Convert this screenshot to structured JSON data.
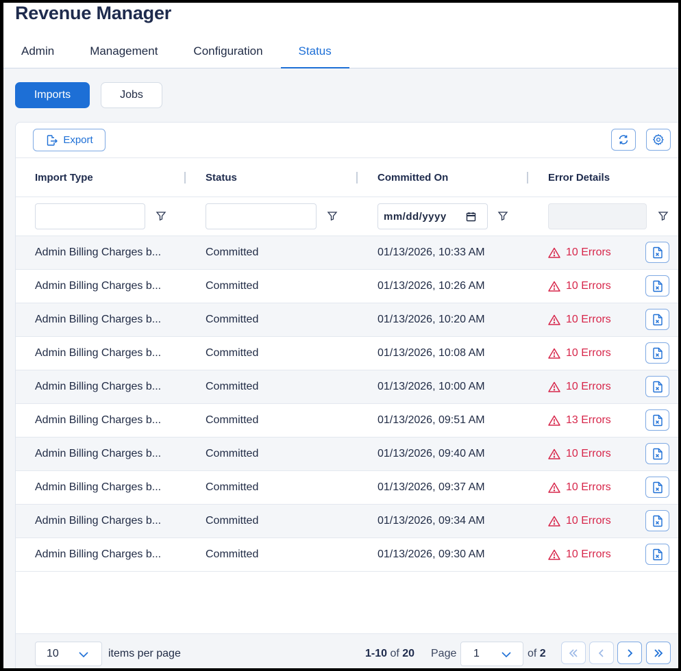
{
  "app": {
    "title": "Revenue Manager"
  },
  "tabs": [
    {
      "label": "Admin"
    },
    {
      "label": "Management"
    },
    {
      "label": "Configuration"
    },
    {
      "label": "Status",
      "active": true
    }
  ],
  "subtabs": [
    {
      "label": "Imports",
      "active": true
    },
    {
      "label": "Jobs"
    }
  ],
  "toolbar": {
    "export_label": "Export"
  },
  "columns": [
    "Import Type",
    "Status",
    "Committed On",
    "Error Details"
  ],
  "filters": {
    "date_placeholder": "mm/dd/yyyy"
  },
  "rows": [
    {
      "import_type": "Admin Billing Charges b...",
      "status": "Committed",
      "committed_on": "01/13/2026, 10:33 AM",
      "errors": "10 Errors"
    },
    {
      "import_type": "Admin Billing Charges b...",
      "status": "Committed",
      "committed_on": "01/13/2026, 10:26 AM",
      "errors": "10 Errors"
    },
    {
      "import_type": "Admin Billing Charges b...",
      "status": "Committed",
      "committed_on": "01/13/2026, 10:20 AM",
      "errors": "10 Errors"
    },
    {
      "import_type": "Admin Billing Charges b...",
      "status": "Committed",
      "committed_on": "01/13/2026, 10:08 AM",
      "errors": "10 Errors"
    },
    {
      "import_type": "Admin Billing Charges b...",
      "status": "Committed",
      "committed_on": "01/13/2026, 10:00 AM",
      "errors": "10 Errors"
    },
    {
      "import_type": "Admin Billing Charges b...",
      "status": "Committed",
      "committed_on": "01/13/2026, 09:51 AM",
      "errors": "13 Errors"
    },
    {
      "import_type": "Admin Billing Charges b...",
      "status": "Committed",
      "committed_on": "01/13/2026, 09:40 AM",
      "errors": "10 Errors"
    },
    {
      "import_type": "Admin Billing Charges b...",
      "status": "Committed",
      "committed_on": "01/13/2026, 09:37 AM",
      "errors": "10 Errors"
    },
    {
      "import_type": "Admin Billing Charges b...",
      "status": "Committed",
      "committed_on": "01/13/2026, 09:34 AM",
      "errors": "10 Errors"
    },
    {
      "import_type": "Admin Billing Charges b...",
      "status": "Committed",
      "committed_on": "01/13/2026, 09:30 AM",
      "errors": "10 Errors"
    }
  ],
  "pagination": {
    "per_page": "10",
    "per_page_label": "items per page",
    "range": "1-10",
    "of_word": "of",
    "total": "20",
    "page_label": "Page",
    "page": "1",
    "page_count": "2"
  },
  "colors": {
    "accent": "#1d6fd6",
    "error": "#d7264a",
    "title": "#1e2b4d"
  },
  "icons": {
    "export": "export-icon",
    "refresh": "refresh-icon",
    "settings": "gear-icon",
    "filter": "filter-icon",
    "calendar": "calendar-icon",
    "warning": "warning-icon",
    "download": "excel-file-icon"
  }
}
